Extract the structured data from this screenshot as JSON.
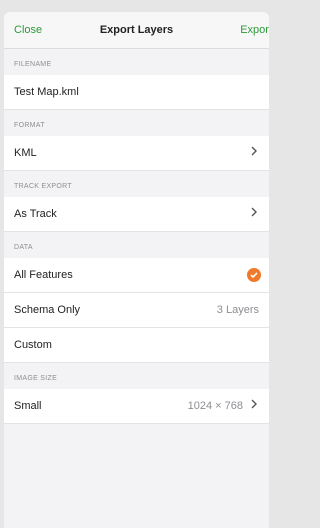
{
  "nav": {
    "close": "Close",
    "title": "Export Layers",
    "export": "Export"
  },
  "sections": {
    "filename": {
      "label": "FILENAME",
      "value": "Test Map.kml"
    },
    "format": {
      "label": "FORMAT",
      "value": "KML"
    },
    "track_export": {
      "label": "TRACK EXPORT",
      "value": "As Track"
    },
    "data": {
      "label": "DATA",
      "rows": [
        {
          "label": "All Features",
          "selected": true
        },
        {
          "label": "Schema Only",
          "detail": "3 Layers"
        },
        {
          "label": "Custom"
        }
      ]
    },
    "image_size": {
      "label": "IMAGE SIZE",
      "value": "Small",
      "detail": "1024 × 768"
    }
  },
  "colors": {
    "accent": "#2e9a3a",
    "check": "#ef7a2c"
  },
  "icons": {
    "chevron": "chevron-right-icon",
    "check": "checkmark-icon"
  }
}
